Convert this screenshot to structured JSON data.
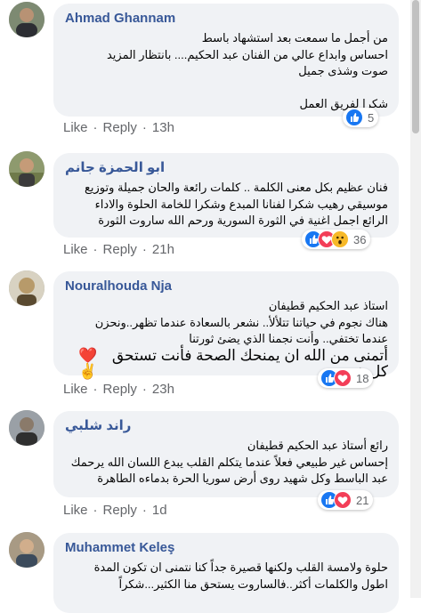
{
  "comments": [
    {
      "author": "Ahmad Ghannam",
      "lines": [
        "من أجمل ما سمعت بعد استشهاد باسط",
        "احساس وابداع عالي من الفنان عبد الحكيم.... بانتظار المزيد",
        "صوت وشذى جميل",
        "",
        "شكرا لفريق العمل"
      ],
      "reaction_count": "5",
      "reactions": [
        "like"
      ],
      "like": "Like",
      "reply": "Reply",
      "time": "13h"
    },
    {
      "author": "ابو الحمزة جانم",
      "lines": [
        "فنان عظيم بكل معنى الكلمة .. كلمات رائعة والحان جميلة وتوزيع",
        "موسيقي رهيب شكرا لفنانا المبدع وشكرا للخامة الحلوة والاداء",
        "الرائع اجمل اغنية في الثورة السورية ورحم الله ساروت الثورة"
      ],
      "reaction_count": "36",
      "reactions": [
        "like",
        "love",
        "wow"
      ],
      "like": "Like",
      "reply": "Reply",
      "time": "21h"
    },
    {
      "author": "Nouralhouda Nja",
      "lines": [
        "استاذ عبد الحكيم قطيفان",
        "هناك نجوم في حياتنا تتلألأ.. نشعر بالسعادة عندما تظهر..ونحزن",
        "عندما تختفي.. وأنت نجمنا الذي يضئ ثورتنا",
        "أتمنى من الله ان يمنحك الصحة فأنت تستحق كل خير"
      ],
      "emojis": "❤️✌️",
      "reaction_count": "18",
      "reactions": [
        "like",
        "love"
      ],
      "like": "Like",
      "reply": "Reply",
      "time": "23h"
    },
    {
      "author": "راند شلبي",
      "lines": [
        "رائع أستاذ عبد الحكيم قطيفان",
        "إحساس غير طبيعي فعلاً عندما يتكلم القلب يبدع اللسان الله يرحمك",
        "عبد الباسط وكل شهيد روى أرض سوريا الحرة بدماءه الطاهرة"
      ],
      "reaction_count": "21",
      "reactions": [
        "like",
        "love"
      ],
      "like": "Like",
      "reply": "Reply",
      "time": "1d"
    },
    {
      "author": "Muhammet Keleş",
      "lines": [
        "حلوة ولامسة القلب ولكنها قصيرة جداً كنا نتمنى ان تكون المدة",
        "اطول والكلمات أكثر..فالساروت يستحق منا الكثير...شكراً"
      ]
    }
  ],
  "colors": {
    "author": "#385898",
    "bubble": "#f0f2f5",
    "meta": "#65676b",
    "like": "#1877f2",
    "love": "#f33e58",
    "wow": "#f7b928"
  }
}
